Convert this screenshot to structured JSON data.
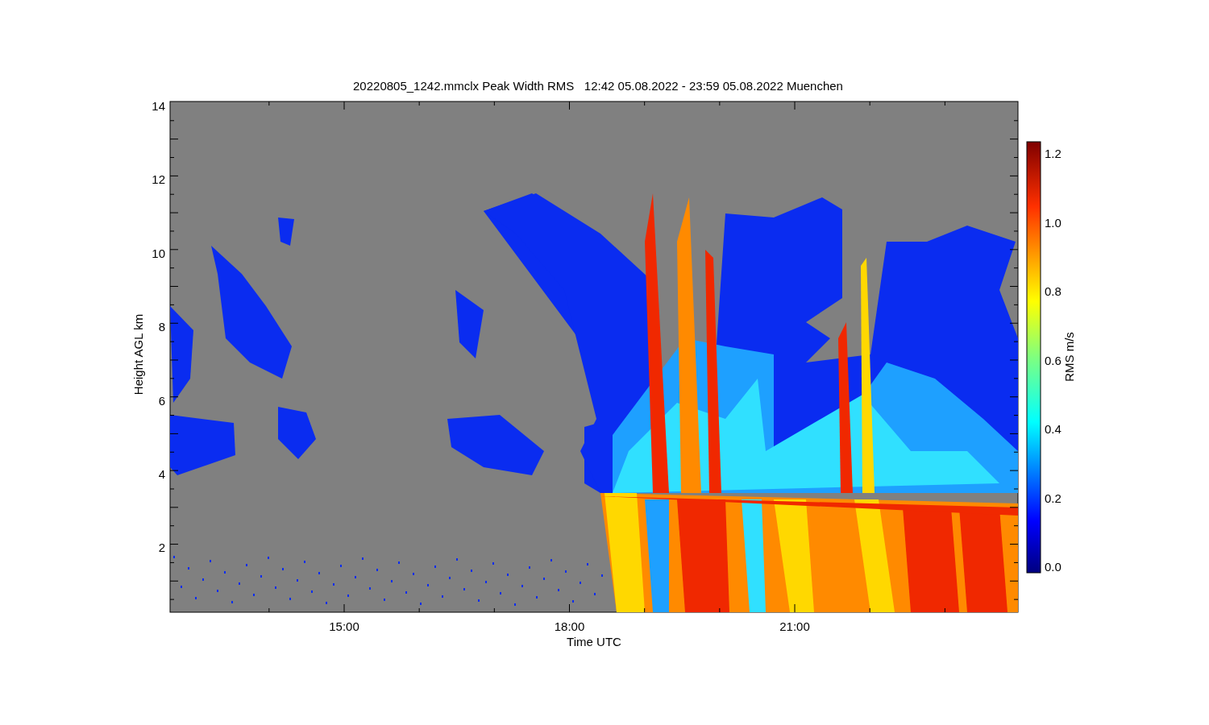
{
  "title": "20220805_1242.mmclx Peak Width RMS   12:42 05.08.2022 - 23:59 05.08.2022 Muenchen",
  "y_axis": {
    "label": "Height AGL km",
    "ticks": [
      "14",
      "12",
      "10",
      "8",
      "6",
      "4",
      "2"
    ]
  },
  "x_axis": {
    "label": "Time UTC",
    "ticks": [
      "15:00",
      "18:00",
      "21:00"
    ]
  },
  "colorbar": {
    "label": "RMS m/s",
    "ticks": [
      "1.2",
      "1.0",
      "0.8",
      "0.6",
      "0.4",
      "0.2",
      "0.0"
    ]
  }
}
